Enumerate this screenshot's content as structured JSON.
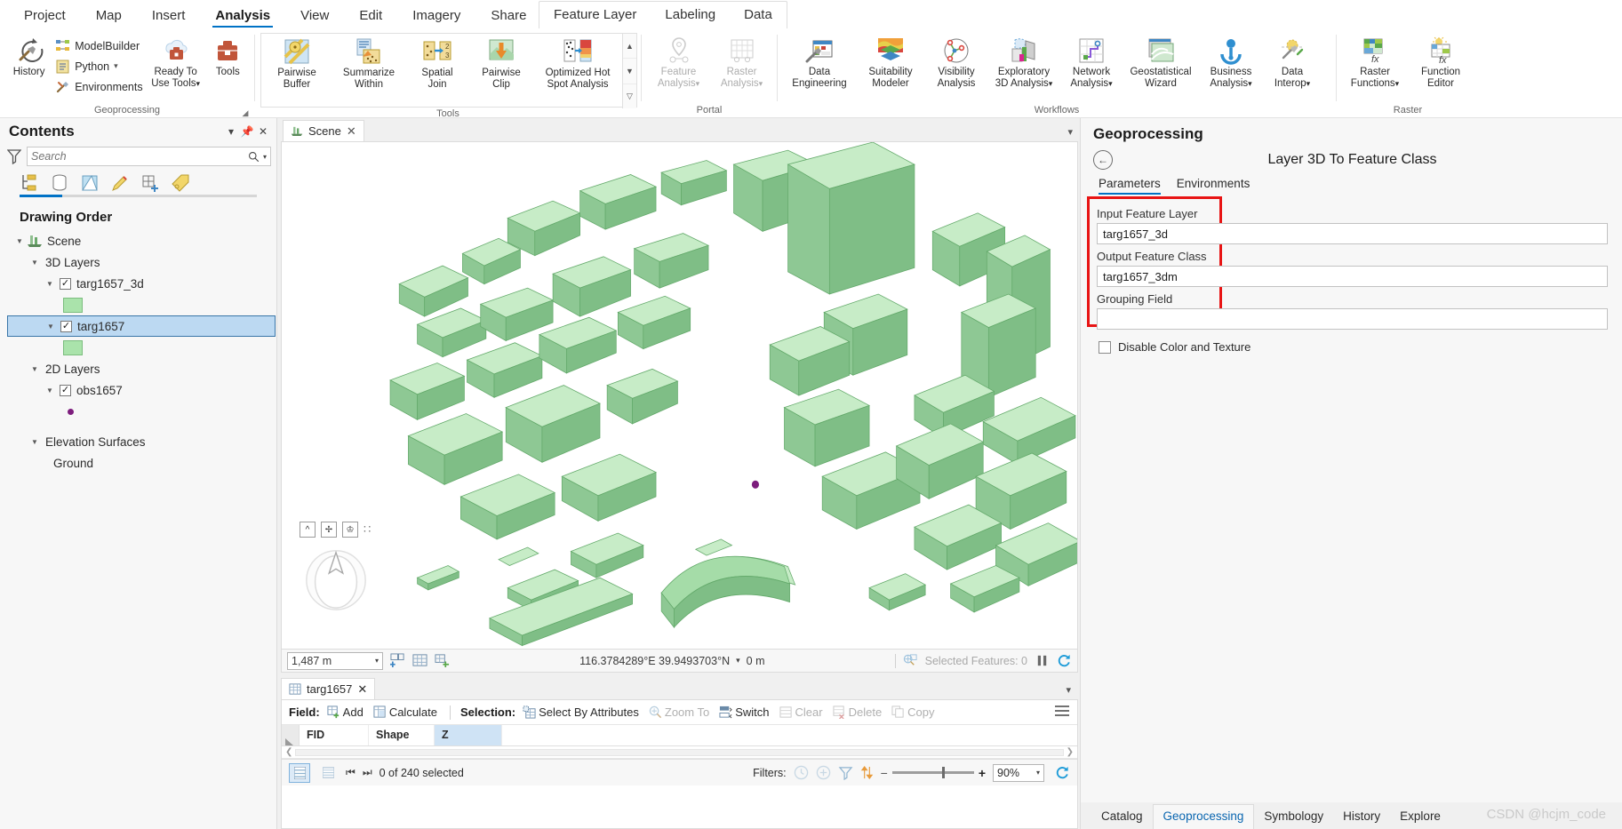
{
  "ribbon": {
    "tabs": [
      {
        "label": "Project",
        "active": false
      },
      {
        "label": "Map",
        "active": false
      },
      {
        "label": "Insert",
        "active": false
      },
      {
        "label": "Analysis",
        "active": true
      },
      {
        "label": "View",
        "active": false
      },
      {
        "label": "Edit",
        "active": false
      },
      {
        "label": "Imagery",
        "active": false
      },
      {
        "label": "Share",
        "active": false
      }
    ],
    "contextual_tabs": [
      {
        "label": "Feature Layer"
      },
      {
        "label": "Labeling"
      },
      {
        "label": "Data"
      }
    ],
    "groups": {
      "geoprocessing": {
        "title": "Geoprocessing",
        "history": "History",
        "model_builder": "ModelBuilder",
        "python": "Python",
        "environments": "Environments",
        "ready_to_use_tools": "Ready To\nUse Tools",
        "ready_to_use_line1": "Ready To",
        "ready_to_use_line2": "Use Tools",
        "tools": "Tools"
      },
      "tools": {
        "title": "Tools",
        "items": [
          {
            "line1": "Pairwise",
            "line2": "Buffer"
          },
          {
            "line1": "Summarize",
            "line2": "Within"
          },
          {
            "line1": "Spatial",
            "line2": "Join"
          },
          {
            "line1": "Pairwise",
            "line2": "Clip"
          },
          {
            "line1": "Optimized Hot",
            "line2": "Spot Analysis"
          }
        ]
      },
      "portal": {
        "title": "Portal",
        "items": [
          {
            "line1": "Feature",
            "line2": "Analysis",
            "disabled": true,
            "dropdown": true
          },
          {
            "line1": "Raster",
            "line2": "Analysis",
            "disabled": true,
            "dropdown": true
          }
        ]
      },
      "workflows": {
        "title": "Workflows",
        "items": [
          {
            "line1": "Data",
            "line2": "Engineering",
            "dropdown": false
          },
          {
            "line1": "Suitability",
            "line2": "Modeler",
            "dropdown": false
          },
          {
            "line1": "Visibility",
            "line2": "Analysis",
            "dropdown": false
          },
          {
            "line1": "Exploratory",
            "line2": "3D Analysis",
            "dropdown": true
          },
          {
            "line1": "Network",
            "line2": "Analysis",
            "dropdown": true
          },
          {
            "line1": "Geostatistical",
            "line2": "Wizard",
            "dropdown": false
          },
          {
            "line1": "Business",
            "line2": "Analysis",
            "dropdown": true
          },
          {
            "line1": "Data",
            "line2": "Interop",
            "dropdown": true
          }
        ]
      },
      "raster": {
        "title": "Raster",
        "items": [
          {
            "line1": "Raster",
            "line2": "Functions",
            "dropdown": true
          },
          {
            "line1": "Function",
            "line2": "Editor",
            "dropdown": false
          }
        ]
      }
    }
  },
  "contents": {
    "title": "Contents",
    "search_placeholder": "Search",
    "drawing_order_label": "Drawing Order",
    "toolbar_icons": [
      "list-by-drawing-order-icon",
      "list-by-data-source-icon",
      "list-by-selection-icon",
      "list-by-editing-icon",
      "list-by-snapping-icon",
      "list-by-labeling-icon"
    ],
    "tree": {
      "scene": "Scene",
      "group_3d": "3D Layers",
      "group_2d": "2D Layers",
      "elevation": "Elevation Surfaces",
      "layers_3d": [
        {
          "name": "targ1657_3d",
          "checked": true,
          "selected": false,
          "symbol": "green-polygon"
        },
        {
          "name": "targ1657",
          "checked": true,
          "selected": true,
          "symbol": "green-polygon"
        }
      ],
      "layers_2d": [
        {
          "name": "obs1657",
          "checked": true,
          "selected": false,
          "symbol": "purple-point"
        }
      ],
      "elevation_items": [
        "Ground"
      ]
    }
  },
  "view": {
    "tab_label": "Scene",
    "scale": "1,487 m",
    "coordinates": "116.3784289°E 39.9493703°N",
    "elevation": "0 m",
    "selected_features": "Selected Features: 0",
    "nav_buttons": [
      "collapse-navigator-icon",
      "full-control-navigator-icon",
      "walk-mode-icon",
      "drag-handle-icon"
    ],
    "status_icons": [
      "add-data-icon",
      "basemap-grid-icon",
      "snapping-icon",
      "selected-features-icon",
      "pause-drawing-icon",
      "refresh-icon"
    ]
  },
  "table": {
    "tab_label": "targ1657",
    "toolbar": {
      "field_label": "Field:",
      "add": "Add",
      "calculate": "Calculate",
      "selection_label": "Selection:",
      "select_by_attributes": "Select By Attributes",
      "zoom_to": "Zoom To",
      "switch": "Switch",
      "clear": "Clear",
      "delete": "Delete",
      "copy": "Copy"
    },
    "columns": [
      {
        "name": "FID",
        "selected": false
      },
      {
        "name": "Shape",
        "selected": false
      },
      {
        "name": "Z",
        "selected": true
      }
    ],
    "rows": [],
    "footer": {
      "selection_count": "0 of 240 selected",
      "filters_label": "Filters:",
      "zoom": "90%"
    }
  },
  "geoprocessing": {
    "title": "Geoprocessing",
    "tool_name": "Layer 3D To Feature Class",
    "tabs": [
      {
        "label": "Parameters",
        "active": true
      },
      {
        "label": "Environments",
        "active": false
      }
    ],
    "parameters": [
      {
        "label": "Input Feature Layer",
        "value": "targ1657_3d"
      },
      {
        "label": "Output Feature Class",
        "value": "targ1657_3dm"
      },
      {
        "label": "Grouping Field",
        "value": ""
      }
    ],
    "checkbox_label": "Disable Color and Texture",
    "checkbox_checked": false,
    "highlight_color": "#e81414"
  },
  "bottom_tabs": [
    {
      "label": "Catalog",
      "active": false
    },
    {
      "label": "Geoprocessing",
      "active": true
    },
    {
      "label": "Symbology",
      "active": false
    },
    {
      "label": "History",
      "active": false
    },
    {
      "label": "Explore",
      "active": false
    }
  ],
  "watermark": "CSDN @hcjm_code",
  "colors": {
    "accent": "#0072c6",
    "building_light": "#bde8bd",
    "building_dark": "#7fc486",
    "selection": "#bcd9f2"
  }
}
